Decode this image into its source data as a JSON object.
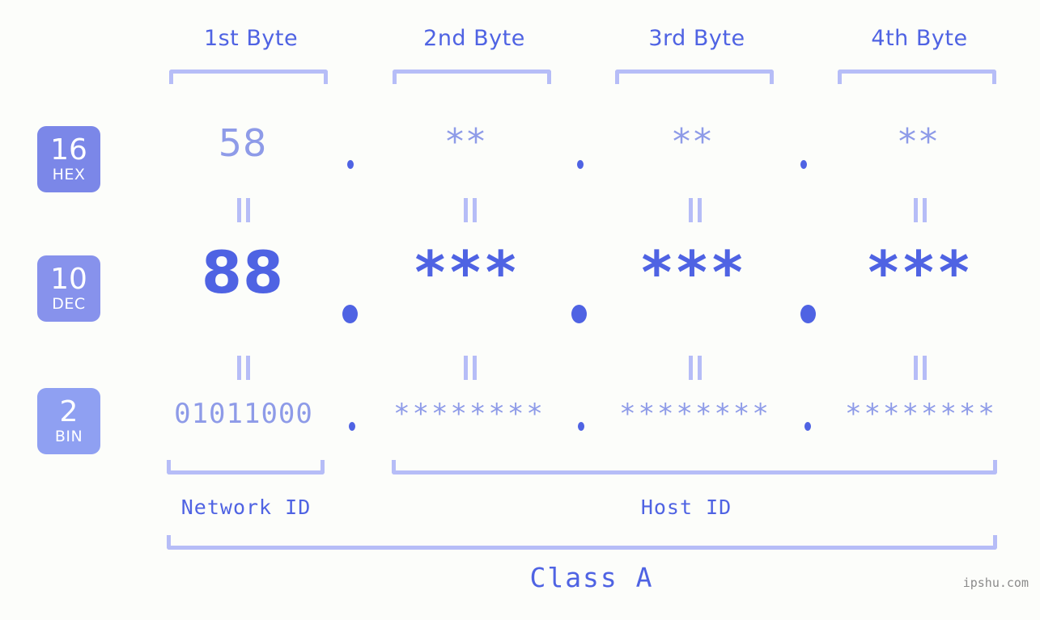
{
  "background_color": "#fcfdfa",
  "accent_colors": {
    "strong_blue": "#4f63e3",
    "light_blue": "#8e9be8",
    "bracket_blue": "#b6bdf7",
    "badge_hex": "#7b87e8",
    "badge_dec": "#8792ec",
    "badge_bin": "#8fa0f2",
    "watermark_gray": "#8b8b8b"
  },
  "byte_headers": [
    {
      "label": "1st Byte"
    },
    {
      "label": "2nd Byte"
    },
    {
      "label": "3rd Byte"
    },
    {
      "label": "4th Byte"
    }
  ],
  "bases": [
    {
      "radix": "16",
      "name": "HEX"
    },
    {
      "radix": "10",
      "name": "DEC"
    },
    {
      "radix": "2",
      "name": "BIN"
    }
  ],
  "rows": {
    "hex": {
      "radix": "16",
      "name": "HEX",
      "values": [
        "58",
        "**",
        "**",
        "**"
      ],
      "separator": "."
    },
    "dec": {
      "radix": "10",
      "name": "DEC",
      "values": [
        "88",
        "***",
        "***",
        "***"
      ],
      "separator": "."
    },
    "bin": {
      "radix": "2",
      "name": "BIN",
      "values": [
        "01011000",
        "********",
        "********",
        "********"
      ],
      "separator": "."
    }
  },
  "equality_symbol": "=",
  "id_sections": {
    "network": {
      "label": "Network ID",
      "bytes": 1
    },
    "host": {
      "label": "Host ID",
      "bytes": 3
    }
  },
  "class": {
    "label": "Class A"
  },
  "watermark": {
    "text": "ipshu.com"
  }
}
